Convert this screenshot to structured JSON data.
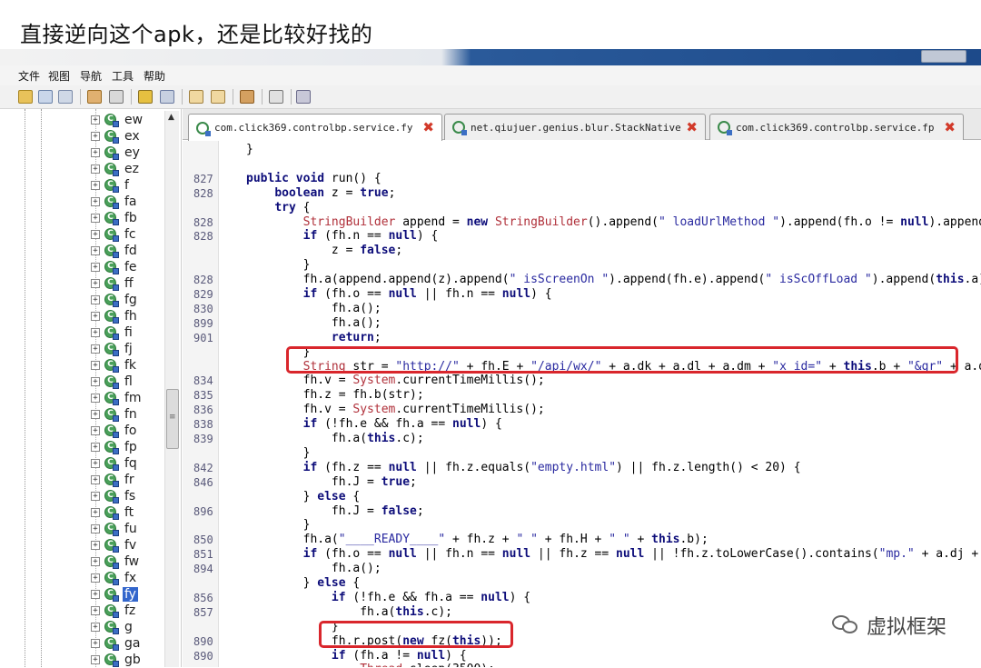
{
  "caption": "直接逆向这个apk，还是比较好找的",
  "menu": [
    "文件",
    "视图",
    "导航",
    "工具",
    "帮助"
  ],
  "tree": {
    "items": [
      {
        "label": "ew"
      },
      {
        "label": "ex"
      },
      {
        "label": "ey"
      },
      {
        "label": "ez"
      },
      {
        "label": "f"
      },
      {
        "label": "fa"
      },
      {
        "label": "fb"
      },
      {
        "label": "fc"
      },
      {
        "label": "fd"
      },
      {
        "label": "fe"
      },
      {
        "label": "ff"
      },
      {
        "label": "fg"
      },
      {
        "label": "fh"
      },
      {
        "label": "fi"
      },
      {
        "label": "fj"
      },
      {
        "label": "fk"
      },
      {
        "label": "fl"
      },
      {
        "label": "fm"
      },
      {
        "label": "fn"
      },
      {
        "label": "fo"
      },
      {
        "label": "fp"
      },
      {
        "label": "fq"
      },
      {
        "label": "fr"
      },
      {
        "label": "fs"
      },
      {
        "label": "ft"
      },
      {
        "label": "fu"
      },
      {
        "label": "fv"
      },
      {
        "label": "fw"
      },
      {
        "label": "fx"
      },
      {
        "label": "fy",
        "selected": true
      },
      {
        "label": "fz"
      },
      {
        "label": "g"
      },
      {
        "label": "ga"
      },
      {
        "label": "gb"
      }
    ]
  },
  "tabs": [
    {
      "label": "com.click369.controlbp.service.fy",
      "active": true
    },
    {
      "label": "net.qiujuer.genius.blur.StackNative",
      "active": false
    },
    {
      "label": "com.click369.controlbp.service.fp",
      "active": false
    }
  ],
  "code": [
    {
      "ln": "",
      "text": "}"
    },
    {
      "ln": "",
      "text": ""
    },
    {
      "ln": "827",
      "text": "public void run() {"
    },
    {
      "ln": "828",
      "text": "    boolean z = true;"
    },
    {
      "ln": "",
      "text": "    try {"
    },
    {
      "ln": "828",
      "text": "        StringBuilder append = new StringBuilder().append(\" loadUrlMethod \").append(fh.o != null).append(\""
    },
    {
      "ln": "828",
      "text": "        if (fh.n == null) {"
    },
    {
      "ln": "",
      "text": "            z = false;"
    },
    {
      "ln": "",
      "text": "        }"
    },
    {
      "ln": "828",
      "text": "        fh.a(append.append(z).append(\" isScreenOn \").append(fh.e).append(\" isScOffLoad \").append(this.a).ap"
    },
    {
      "ln": "829",
      "text": "        if (fh.o == null || fh.n == null) {"
    },
    {
      "ln": "830",
      "text": "            fh.a();"
    },
    {
      "ln": "899",
      "text": "            fh.a();"
    },
    {
      "ln": "901",
      "text": "            return;"
    },
    {
      "ln": "",
      "text": "        }"
    },
    {
      "ln": "",
      "text": "        String str = \"http://\" + fh.E + \"/api/wx/\" + a.dk + a.dl + a.dm + \"x_id=\" + this.b + \"&gr\" + a.dn +"
    },
    {
      "ln": "834",
      "text": "        fh.v = System.currentTimeMillis();"
    },
    {
      "ln": "835",
      "text": "        fh.z = fh.b(str);"
    },
    {
      "ln": "836",
      "text": "        fh.v = System.currentTimeMillis();"
    },
    {
      "ln": "838",
      "text": "        if (!fh.e && fh.a == null) {"
    },
    {
      "ln": "839",
      "text": "            fh.a(this.c);"
    },
    {
      "ln": "",
      "text": "        }"
    },
    {
      "ln": "842",
      "text": "        if (fh.z == null || fh.z.equals(\"empty.html\") || fh.z.length() < 20) {"
    },
    {
      "ln": "846",
      "text": "            fh.J = true;"
    },
    {
      "ln": "",
      "text": "        } else {"
    },
    {
      "ln": "896",
      "text": "            fh.J = false;"
    },
    {
      "ln": "",
      "text": "        }"
    },
    {
      "ln": "850",
      "text": "        fh.a(\"____READY____\" + fh.z + \" \" + fh.H + \" \" + this.b);"
    },
    {
      "ln": "851",
      "text": "        if (fh.o == null || fh.n == null || fh.z == null || !fh.z.toLowerCase().contains(\"mp.\" + a.dj + \""
    },
    {
      "ln": "894",
      "text": "            fh.a();"
    },
    {
      "ln": "",
      "text": "        } else {"
    },
    {
      "ln": "856",
      "text": "            if (!fh.e && fh.a == null) {"
    },
    {
      "ln": "857",
      "text": "                fh.a(this.c);"
    },
    {
      "ln": "",
      "text": "            }"
    },
    {
      "ln": "890",
      "text": "            fh.r.post(new fz(this));"
    },
    {
      "ln": "890",
      "text": "            if (fh.a != null) {"
    },
    {
      "ln": "",
      "text": "                Thread.sleep(3500);"
    }
  ],
  "watermark": "虚拟框架",
  "colors": {
    "highlight_box": "#d9262c",
    "selected_node": "#3366cc",
    "keyword": "#0d0d7a",
    "string": "#2a2aa0"
  }
}
